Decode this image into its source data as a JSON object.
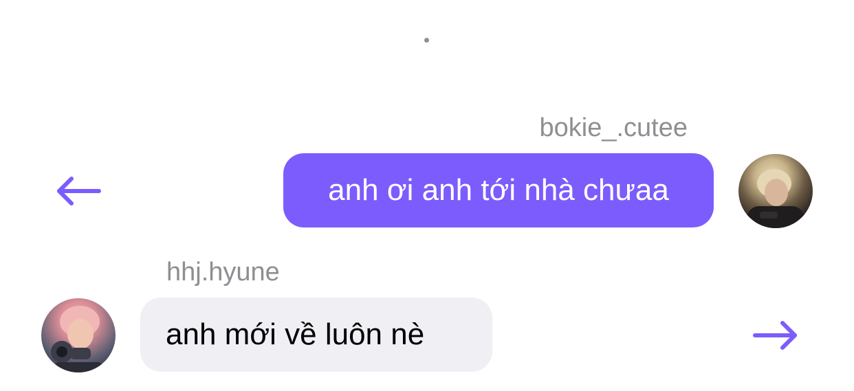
{
  "conversation": {
    "sent": {
      "username": "bokie_.cutee",
      "text": "anh ơi anh tới nhà chưaa"
    },
    "received": {
      "username": "hhj.hyune",
      "text": "anh mới về luôn nè"
    }
  },
  "icons": {
    "left_arrow": "arrow-left-icon",
    "right_arrow": "arrow-right-icon"
  },
  "colors": {
    "accent": "#7c5cfc",
    "received_bubble": "#efeff4",
    "username_gray": "#8e8e93"
  }
}
